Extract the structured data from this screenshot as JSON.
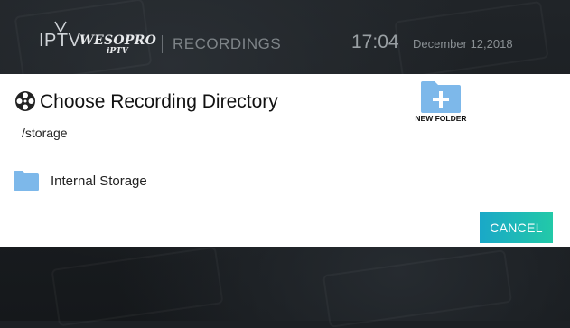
{
  "header": {
    "logo_text": "IPTV",
    "brand": "WESOPRO",
    "brand_sub": "iPTV",
    "section": "RECORDINGS",
    "time": "17:04",
    "date": "December 12,2018"
  },
  "dialog": {
    "title": "Choose Recording Directory",
    "title_icon": "film-reel-icon",
    "current_path": "/storage",
    "new_folder_label": "NEW FOLDER",
    "new_folder_icon": "folder-plus-icon",
    "items": [
      {
        "label": "Internal Storage",
        "icon": "folder-icon"
      }
    ],
    "cancel_label": "CANCEL"
  },
  "colors": {
    "folder": "#7db8ea",
    "cancel_start": "#1aa8c8",
    "cancel_end": "#22c9a8",
    "dialog_bg": "#ffffff",
    "page_bg": "#1c2024"
  }
}
